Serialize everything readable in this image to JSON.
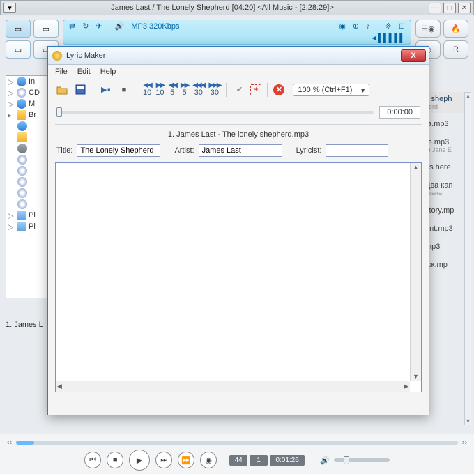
{
  "main": {
    "title": "James Last / The Lonely Shepherd  [04:20]    <All Music - [2:28:29]>",
    "info_format": "MP3 320Kbps"
  },
  "tree": {
    "items": [
      {
        "icon": "music",
        "label": "In"
      },
      {
        "icon": "cd",
        "label": "CD"
      },
      {
        "icon": "music",
        "label": "M"
      },
      {
        "icon": "folder",
        "label": "Br",
        "expanded": true
      },
      {
        "icon": "pl",
        "label": "Pl"
      },
      {
        "icon": "pl",
        "label": "Pl"
      }
    ],
    "below": "1. James L"
  },
  "rightlist": [
    {
      "t": "y sheph",
      "sub": "herd",
      "sel": true
    },
    {
      "t": "ta.mp3"
    },
    {
      "t": "re.mp3",
      "sub": "ф Jane E"
    },
    {
      "t": "as here."
    },
    {
      "t": "Два кап",
      "sub": "итана"
    },
    {
      "t": "story.mp"
    },
    {
      "t": "ent.mp3"
    },
    {
      "t": "mp3"
    },
    {
      "t": "аж.mp"
    }
  ],
  "player": {
    "track": "44",
    "num": "1",
    "time": "0:01:26"
  },
  "dialog": {
    "title": "Lyric Maker",
    "menu": {
      "file": "File",
      "edit": "Edit",
      "help": "Help"
    },
    "zoom": "100 % (Ctrl+F1)",
    "seek": [
      "10",
      "10",
      "5",
      "5",
      "30",
      "30"
    ],
    "time": "0:00:00",
    "song": "1. James Last - The lonely shepherd.mp3",
    "labels": {
      "title": "Title:",
      "artist": "Artist:",
      "lyricist": "Lyricist:"
    },
    "fields": {
      "title": "The Lonely Shepherd",
      "artist": "James Last",
      "lyricist": ""
    }
  }
}
